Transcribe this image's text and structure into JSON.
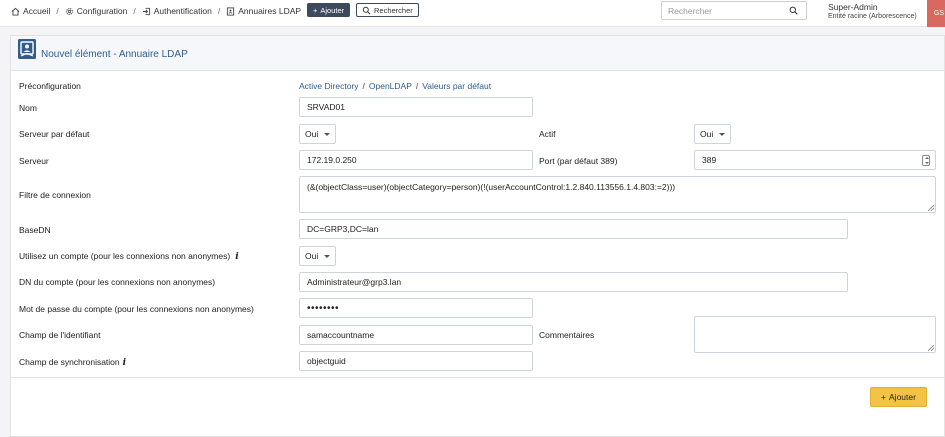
{
  "breadcrumb": {
    "home": "Accueil",
    "configuration": "Configuration",
    "authentification": "Authentification",
    "ldap": "Annuaires LDAP"
  },
  "toolbar": {
    "add_label": "Ajouter",
    "search_label": "Rechercher"
  },
  "search": {
    "placeholder": "Rechercher"
  },
  "user": {
    "name": "Super-Admin",
    "entity": "Entité racine (Arborescence)",
    "initials": "GS"
  },
  "form": {
    "title": "Nouvel élément - Annuaire LDAP",
    "preconfig_label": "Préconfiguration",
    "preconfig_links": [
      "Active Directory",
      "OpenLDAP",
      "Valeurs par défaut"
    ],
    "name_label": "Nom",
    "name_value": "SRVAD01",
    "default_server_label": "Serveur par défaut",
    "default_server_value": "Oui",
    "active_label": "Actif",
    "active_value": "Oui",
    "server_label": "Serveur",
    "server_value": "172.19.0.250",
    "port_label": "Port (par défaut 389)",
    "port_value": "389",
    "filter_label": "Filtre de connexion",
    "filter_value": "(&(objectClass=user)(objectCategory=person)(!(userAccountControl:1.2.840.113556.1.4.803:=2)))",
    "basedn_label": "BaseDN",
    "basedn_value": "DC=GRP3,DC=lan",
    "use_account_label": "Utilisez un compte (pour les connexions non anonymes)",
    "use_account_value": "Oui",
    "account_dn_label": "DN du compte (pour les connexions non anonymes)",
    "account_dn_value": "Administrateur@grp3.lan",
    "password_label": "Mot de passe du compte (pour les connexions non anonymes)",
    "password_value": "••••••••",
    "login_field_label": "Champ de l'identifiant",
    "login_field_value": "samaccountname",
    "comments_label": "Commentaires",
    "comments_value": "",
    "sync_field_label": "Champ de synchronisation",
    "sync_field_value": "objectguid",
    "submit_label": "Ajouter"
  },
  "colors": {
    "accent": "#2f5d8c",
    "submit": "#f4c345",
    "topbutton": "#3d4a5e",
    "avatar": "#d9695f"
  }
}
